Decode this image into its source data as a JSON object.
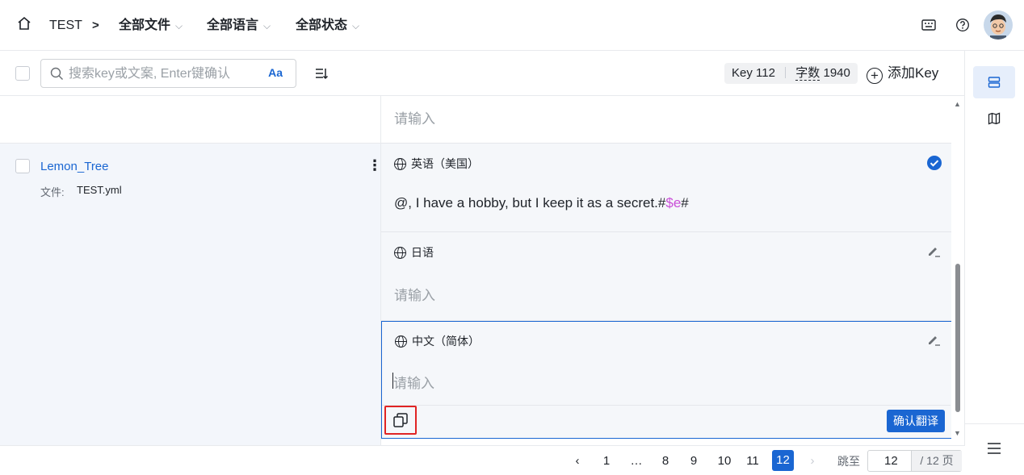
{
  "topbar": {
    "project": "TEST",
    "filters": [
      "全部文件",
      "全部语言",
      "全部状态"
    ]
  },
  "toolbar": {
    "search_placeholder": "搜索key或文案, Enter键确认",
    "case_toggle": "Aa",
    "key_label": "Key",
    "key_count": "112",
    "word_label": "字数",
    "word_count": "1940",
    "add_key": "添加Key"
  },
  "top_partial": {
    "placeholder": "请输入"
  },
  "key": {
    "name": "Lemon_Tree",
    "file_label": "文件:",
    "file_name": "TEST.yml"
  },
  "translations": [
    {
      "language": "英语（美国）",
      "text_before": "@, I have a hobby, but I keep it as a secret.#",
      "text_var": "$e",
      "text_after": "#",
      "status": "confirmed"
    },
    {
      "language": "日语",
      "placeholder": "请输入"
    },
    {
      "language": "中文（简体）",
      "placeholder": "请输入",
      "confirm_button": "确认翻译"
    }
  ],
  "pagination": {
    "pages": [
      "1",
      "…",
      "8",
      "9",
      "10",
      "11",
      "12"
    ],
    "current": "12",
    "jump_label": "跳至",
    "jump_value": "12",
    "total": "/ 12 页"
  },
  "colors": {
    "accent": "#1a66d2",
    "variable": "#c94fd8",
    "highlight": "#e02424"
  }
}
